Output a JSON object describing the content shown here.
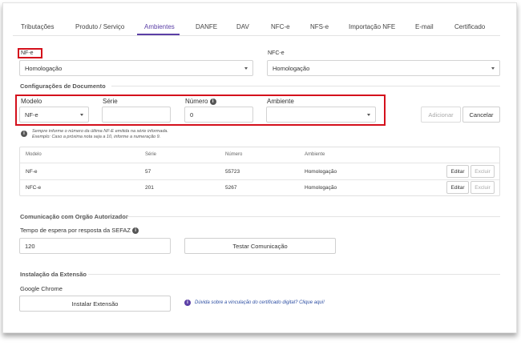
{
  "tabs": [
    {
      "label": "Tributações"
    },
    {
      "label": "Produto / Serviço"
    },
    {
      "label": "Ambientes"
    },
    {
      "label": "DANFE"
    },
    {
      "label": "DAV"
    },
    {
      "label": "NFC-e"
    },
    {
      "label": "NFS-e"
    },
    {
      "label": "Importação NFE"
    },
    {
      "label": "E-mail"
    },
    {
      "label": "Certificado"
    }
  ],
  "env": {
    "nfe_label": "NF-e",
    "nfe_value": "Homologação",
    "nfce_label": "NFC-e",
    "nfce_value": "Homologação"
  },
  "config": {
    "title": "Configurações de Documento",
    "modelo_label": "Modelo",
    "modelo_value": "NF-e",
    "serie_label": "Série",
    "serie_value": "",
    "numero_label": "Número",
    "numero_value": "0",
    "ambiente_label": "Ambiente",
    "ambiente_value": "",
    "add_label": "Adicionar",
    "cancel_label": "Cancelar",
    "note_line1": "Sempre informe o número da última NF-E emitida na série informada.",
    "note_line2": "Exemplo: Caso a próxima nota seja a 10, informe a numeração 9."
  },
  "table": {
    "headers": [
      "Modelo",
      "Série",
      "Número",
      "Ambiente"
    ],
    "rows": [
      {
        "modelo": "NF-e",
        "serie": "57",
        "numero": "55723",
        "ambiente": "Homologação"
      },
      {
        "modelo": "NFC-e",
        "serie": "201",
        "numero": "5267",
        "ambiente": "Homologação"
      }
    ],
    "edit_label": "Editar",
    "delete_label": "Excluir"
  },
  "comms": {
    "title": "Comunicação com Orgão Autorizador",
    "timeout_label": "Tempo de espera por resposta da SEFAZ",
    "timeout_value": "120",
    "test_label": "Testar Comunicação"
  },
  "extension": {
    "title": "Instalação da Extensão",
    "browser_label": "Google Chrome",
    "install_label": "Instalar Extensão",
    "help_link": "Dúvida sobre a vinculação do certificado digital? Clique aqui!"
  }
}
